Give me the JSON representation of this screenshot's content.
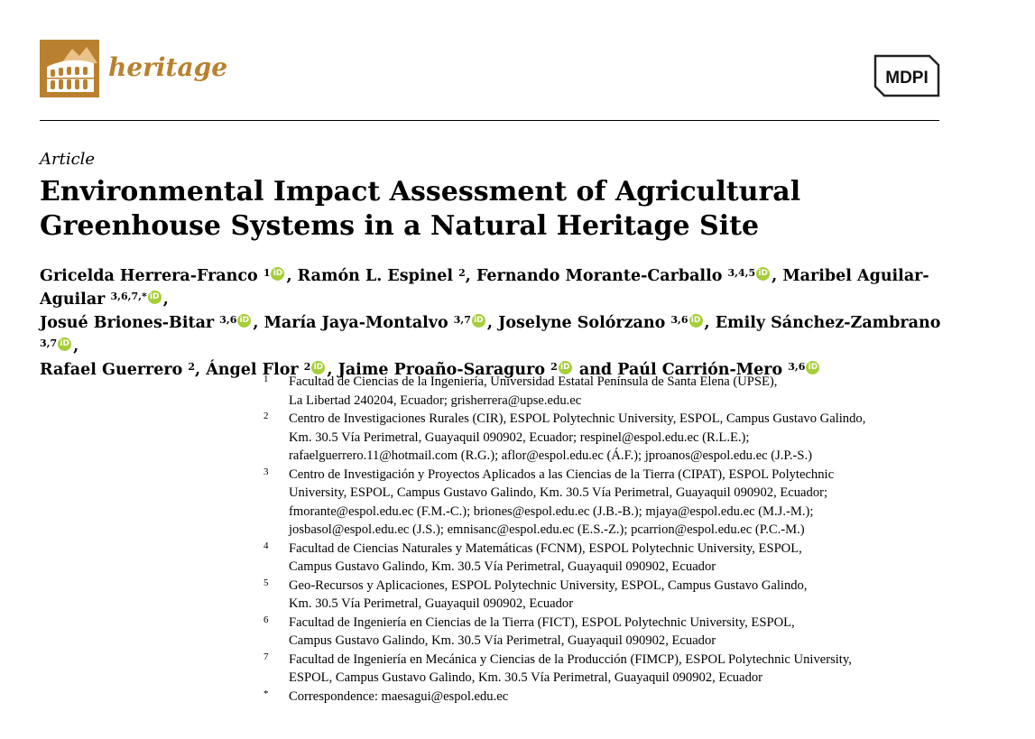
{
  "header": {
    "journal": "heritage",
    "publisher": "MDPI",
    "brand_color": "#b9812f"
  },
  "article_type": "Article",
  "title": "Environmental Impact Assessment of Agricultural Greenhouse Systems in a Natural Heritage Site",
  "authors": [
    {
      "name": "Gricelda Herrera-Franco",
      "aff": "1",
      "orcid": true,
      "sep": ", "
    },
    {
      "name": "Ramón L. Espinel",
      "aff": "2",
      "orcid": false,
      "sep": ", "
    },
    {
      "name": "Fernando Morante-Carballo",
      "aff": "3,4,5",
      "orcid": true,
      "sep": ", "
    },
    {
      "name": "Maribel Aguilar-Aguilar",
      "aff": "3,6,7,*",
      "orcid": true,
      "sep": ","
    },
    {
      "name": "Josué Briones-Bitar",
      "aff": "3,6",
      "orcid": true,
      "sep": ", "
    },
    {
      "name": "María Jaya-Montalvo",
      "aff": "3,7",
      "orcid": true,
      "sep": ", "
    },
    {
      "name": "Joselyne Solórzano",
      "aff": "3,6",
      "orcid": true,
      "sep": ", "
    },
    {
      "name": "Emily Sánchez-Zambrano",
      "aff": "3,7",
      "orcid": true,
      "sep": ","
    },
    {
      "name": "Rafael Guerrero",
      "aff": "2",
      "orcid": false,
      "sep": ", "
    },
    {
      "name": "Ángel Flor",
      "aff": "2",
      "orcid": true,
      "sep": ", "
    },
    {
      "name": "Jaime Proaño-Saraguro",
      "aff": "2",
      "orcid": true,
      "sep": " and "
    },
    {
      "name": "Paúl Carrión-Mero",
      "aff": "3,6",
      "orcid": true,
      "sep": ""
    }
  ],
  "affiliations": [
    {
      "num": "1",
      "lines": [
        "Facultad de Ciencias de la Ingeniería, Universidad Estatal Península de Santa Elena (UPSE),",
        "La Libertad 240204, Ecuador; grisherrera@upse.edu.ec"
      ]
    },
    {
      "num": "2",
      "lines": [
        "Centro de Investigaciones Rurales (CIR), ESPOL Polytechnic University, ESPOL, Campus Gustavo Galindo,",
        "Km. 30.5 Vía Perimetral, Guayaquil 090902, Ecuador; respinel@espol.edu.ec (R.L.E.);",
        "rafaelguerrero.11@hotmail.com (R.G.); aflor@espol.edu.ec (Á.F.); jproanos@espol.edu.ec (J.P.-S.)"
      ]
    },
    {
      "num": "3",
      "lines": [
        "Centro de Investigación y Proyectos Aplicados a las Ciencias de la Tierra (CIPAT), ESPOL Polytechnic",
        "University, ESPOL, Campus Gustavo Galindo, Km. 30.5 Vía Perimetral, Guayaquil 090902, Ecuador;",
        "fmorante@espol.edu.ec (F.M.-C.); briones@espol.edu.ec (J.B.-B.); mjaya@espol.edu.ec (M.J.-M.);",
        "josbasol@espol.edu.ec (J.S.); emnisanc@espol.edu.ec (E.S.-Z.); pcarrion@espol.edu.ec (P.C.-M.)"
      ]
    },
    {
      "num": "4",
      "lines": [
        "Facultad de Ciencias Naturales y Matemáticas (FCNM), ESPOL Polytechnic University, ESPOL,",
        "Campus Gustavo Galindo, Km. 30.5 Vía Perimetral, Guayaquil 090902, Ecuador"
      ]
    },
    {
      "num": "5",
      "lines": [
        "Geo-Recursos y Aplicaciones, ESPOL Polytechnic University, ESPOL, Campus Gustavo Galindo,",
        "Km. 30.5 Vía Perimetral, Guayaquil 090902, Ecuador"
      ]
    },
    {
      "num": "6",
      "lines": [
        "Facultad de Ingeniería en Ciencias de la Tierra (FICT), ESPOL Polytechnic University, ESPOL,",
        "Campus Gustavo Galindo, Km. 30.5 Vía Perimetral, Guayaquil 090902, Ecuador"
      ]
    },
    {
      "num": "7",
      "lines": [
        "Facultad de Ingeniería en Mecánica y Ciencias de la Producción (FIMCP), ESPOL Polytechnic University,",
        "ESPOL, Campus Gustavo Galindo, Km. 30.5 Vía Perimetral, Guayaquil 090902, Ecuador"
      ]
    },
    {
      "num": "*",
      "lines": [
        "Correspondence: maesagui@espol.edu.ec"
      ]
    }
  ],
  "icons": {
    "orcid": "orcid-icon",
    "journal_logo": "colosseum-icon",
    "publisher_logo": "mdpi-logo"
  }
}
